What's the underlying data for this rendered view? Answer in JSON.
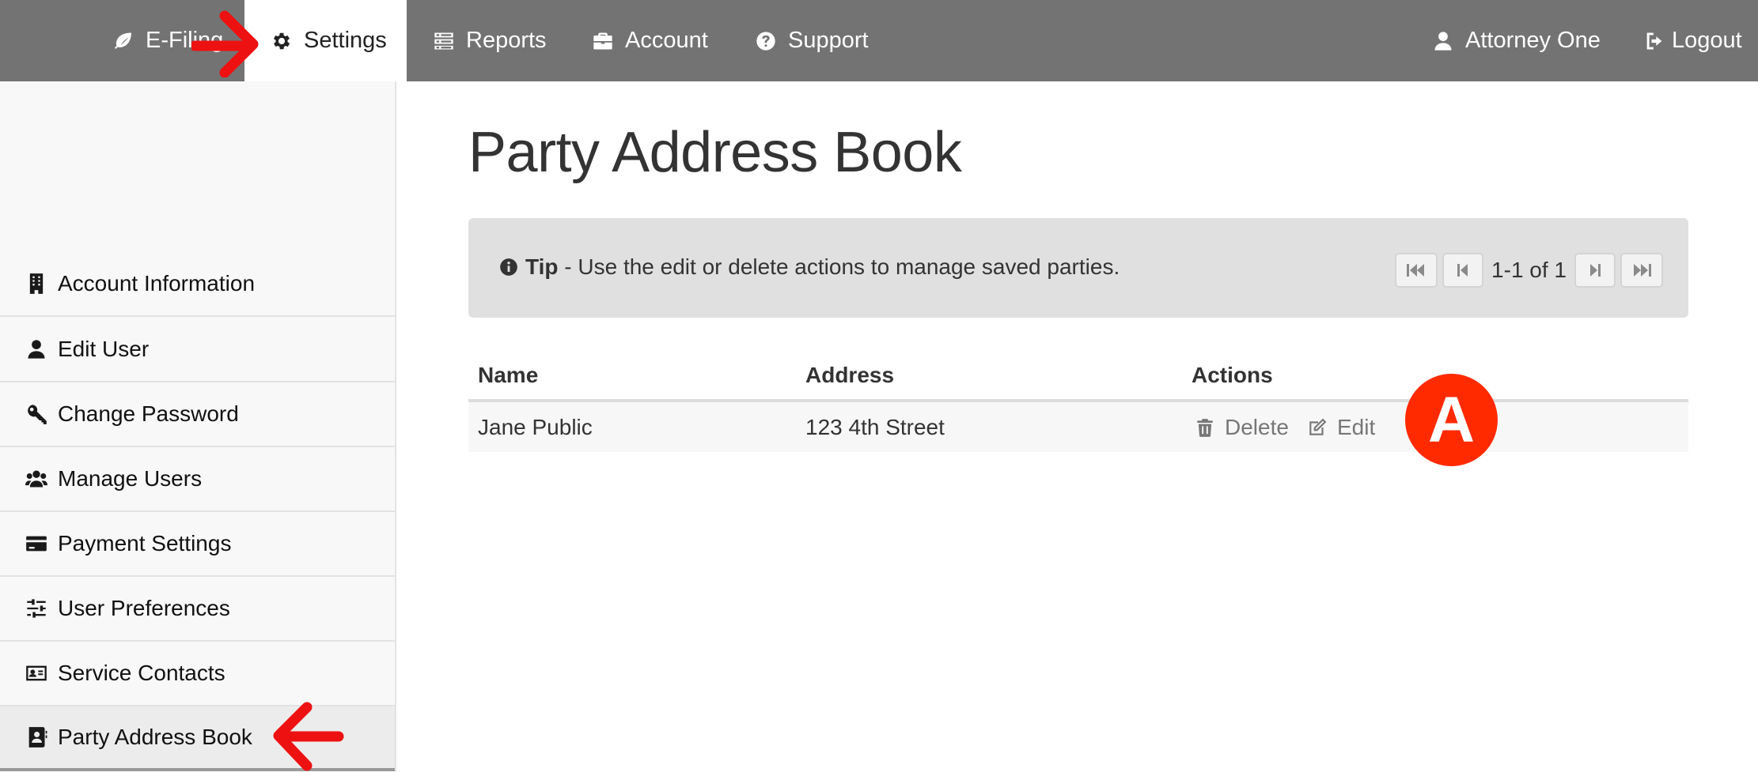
{
  "nav": {
    "efiling": "E-Filing",
    "settings": "Settings",
    "reports": "Reports",
    "account": "Account",
    "support": "Support",
    "user": "Attorney One",
    "logout": "Logout"
  },
  "sidebar": {
    "items": [
      {
        "label": "Account Information",
        "icon": "building-icon"
      },
      {
        "label": "Edit User",
        "icon": "user-icon"
      },
      {
        "label": "Change Password",
        "icon": "key-icon"
      },
      {
        "label": "Manage Users",
        "icon": "users-icon"
      },
      {
        "label": "Payment Settings",
        "icon": "credit-card-icon"
      },
      {
        "label": "User Preferences",
        "icon": "sliders-icon"
      },
      {
        "label": "Service Contacts",
        "icon": "contact-card-icon"
      },
      {
        "label": "Party Address Book",
        "icon": "address-book-icon"
      }
    ],
    "active_index": 7
  },
  "main": {
    "title": "Party Address Book",
    "tip": {
      "label": "Tip",
      "text": " - Use the edit or delete actions to manage saved parties."
    },
    "pagination": {
      "info": "1-1 of 1"
    },
    "table": {
      "columns": [
        "Name",
        "Address",
        "Actions"
      ],
      "rows": [
        {
          "name": "Jane Public",
          "address": "123 4th Street",
          "delete_label": "Delete",
          "edit_label": "Edit"
        }
      ]
    }
  },
  "annotation": {
    "marker_label": "A",
    "marker_color": "#ff2a00",
    "arrow_color": "#ee1111"
  },
  "colors": {
    "navbar": "#737373",
    "sidebar": "#f8f8f8",
    "tip_box": "#e0e0e0"
  }
}
